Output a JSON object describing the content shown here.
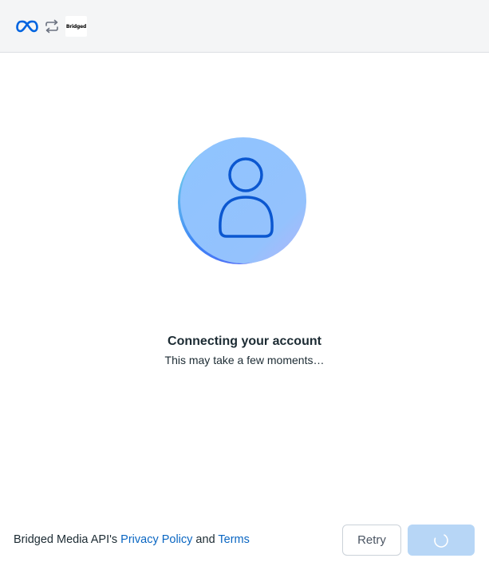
{
  "header": {
    "meta_logo_icon": "meta-infinity-logo",
    "sync_icon": "sync-arrows-icon",
    "app_logo_text": "Bridged"
  },
  "main": {
    "avatar_icon": "user-avatar-icon",
    "title": "Connecting your account",
    "subtitle": "This may take a few moments…"
  },
  "footer": {
    "prefix": "Bridged Media API's ",
    "privacy_link": "Privacy Policy",
    "conjunction": " and ",
    "terms_link": "Terms",
    "retry_label": "Retry",
    "continue_state": "loading",
    "spinner_icon": "loading-spinner-icon"
  },
  "colors": {
    "header_bg": "#f4f5f6",
    "meta_blue": "#0064e0",
    "link": "#0a66c2",
    "avatar_fill": "#90c2fd",
    "avatar_line": "#0b57d0",
    "primary_disabled": "#b7d6f6"
  }
}
